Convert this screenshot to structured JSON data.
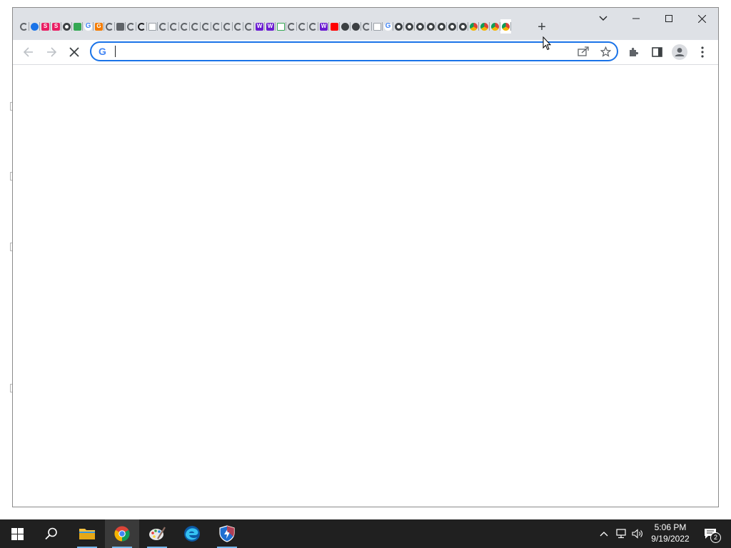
{
  "browser": {
    "app": "Google Chrome",
    "tabs": [
      {
        "icon": "spiral-favicon",
        "color": "#5f6368",
        "shape": "spiral",
        "letter": "",
        "active": false
      },
      {
        "icon": "unknown-favicon",
        "color": "#1a73e8",
        "shape": "round",
        "letter": "",
        "active": false
      },
      {
        "icon": "s-favicon",
        "color": "#e91e63",
        "shape": "square",
        "letter": "S",
        "active": false
      },
      {
        "icon": "s-favicon",
        "color": "#e91e63",
        "shape": "square",
        "letter": "S",
        "active": false
      },
      {
        "icon": "github-favicon",
        "color": "#3c4043",
        "shape": "gh",
        "letter": "",
        "active": false
      },
      {
        "icon": "green-favicon",
        "color": "#34a853",
        "shape": "square",
        "letter": "",
        "active": false
      },
      {
        "icon": "google-favicon",
        "color": "#4285f4",
        "shape": "round",
        "letter": "G",
        "active": false
      },
      {
        "icon": "orange-favicon",
        "color": "#f57c00",
        "shape": "square",
        "letter": "G",
        "active": false
      },
      {
        "icon": "spiral-favicon",
        "color": "#5f6368",
        "shape": "spiral",
        "letter": "",
        "active": false
      },
      {
        "icon": "note-favicon",
        "color": "#5f6368",
        "shape": "square",
        "letter": "",
        "active": false
      },
      {
        "icon": "spiral-favicon",
        "color": "#5f6368",
        "shape": "spiral",
        "letter": "",
        "active": false
      },
      {
        "icon": "spiral-dark-favicon",
        "color": "#202124",
        "shape": "spiral",
        "letter": "",
        "active": false
      },
      {
        "icon": "page-favicon",
        "color": "#9aa0a6",
        "shape": "page",
        "letter": "",
        "active": false
      },
      {
        "icon": "spiral-favicon",
        "color": "#5f6368",
        "shape": "spiral",
        "letter": "",
        "active": false
      },
      {
        "icon": "spiral-favicon",
        "color": "#5f6368",
        "shape": "spiral",
        "letter": "",
        "active": false
      },
      {
        "icon": "spiral-favicon",
        "color": "#5f6368",
        "shape": "spiral",
        "letter": "",
        "active": false
      },
      {
        "icon": "spiral-favicon",
        "color": "#5f6368",
        "shape": "spiral",
        "letter": "",
        "active": false
      },
      {
        "icon": "spiral-favicon",
        "color": "#5f6368",
        "shape": "spiral",
        "letter": "",
        "active": false
      },
      {
        "icon": "spiral-favicon",
        "color": "#5f6368",
        "shape": "spiral",
        "letter": "",
        "active": false
      },
      {
        "icon": "spiral-favicon",
        "color": "#5f6368",
        "shape": "spiral",
        "letter": "",
        "active": false
      },
      {
        "icon": "spiral-favicon",
        "color": "#5f6368",
        "shape": "spiral",
        "letter": "",
        "active": false
      },
      {
        "icon": "spiral-favicon",
        "color": "#5f6368",
        "shape": "spiral",
        "letter": "",
        "active": false
      },
      {
        "icon": "w-favicon",
        "color": "#6a1bd1",
        "shape": "square",
        "letter": "W",
        "active": false
      },
      {
        "icon": "w-favicon",
        "color": "#6a1bd1",
        "shape": "square",
        "letter": "W",
        "active": false
      },
      {
        "icon": "page-favicon",
        "color": "#34a853",
        "shape": "page",
        "letter": "",
        "active": false
      },
      {
        "icon": "spiral-favicon",
        "color": "#5f6368",
        "shape": "spiral",
        "letter": "",
        "active": false
      },
      {
        "icon": "spiral-favicon",
        "color": "#5f6368",
        "shape": "spiral",
        "letter": "",
        "active": false
      },
      {
        "icon": "spiral-favicon",
        "color": "#5f6368",
        "shape": "spiral",
        "letter": "",
        "active": false
      },
      {
        "icon": "w-favicon",
        "color": "#6a1bd1",
        "shape": "square",
        "letter": "W",
        "active": false
      },
      {
        "icon": "youtube-favicon",
        "color": "#ff0000",
        "shape": "square",
        "letter": "",
        "active": false
      },
      {
        "icon": "headphones-favicon",
        "color": "#3c4043",
        "shape": "round",
        "letter": "",
        "active": false
      },
      {
        "icon": "headphones-favicon",
        "color": "#3c4043",
        "shape": "round",
        "letter": "",
        "active": false
      },
      {
        "icon": "spiral-favicon",
        "color": "#5f6368",
        "shape": "spiral",
        "letter": "",
        "active": false
      },
      {
        "icon": "page-favicon",
        "color": "#9aa0a6",
        "shape": "page",
        "letter": "",
        "active": false
      },
      {
        "icon": "google-favicon",
        "color": "#4285f4",
        "shape": "round",
        "letter": "G",
        "active": false
      },
      {
        "icon": "github-favicon",
        "color": "#3c4043",
        "shape": "gh",
        "letter": "",
        "active": false
      },
      {
        "icon": "github-favicon",
        "color": "#3c4043",
        "shape": "gh",
        "letter": "",
        "active": false
      },
      {
        "icon": "github-favicon",
        "color": "#3c4043",
        "shape": "gh",
        "letter": "",
        "active": false
      },
      {
        "icon": "github-favicon",
        "color": "#3c4043",
        "shape": "gh",
        "letter": "",
        "active": false
      },
      {
        "icon": "github-favicon",
        "color": "#3c4043",
        "shape": "gh",
        "letter": "",
        "active": false
      },
      {
        "icon": "github-favicon",
        "color": "#3c4043",
        "shape": "gh",
        "letter": "",
        "active": false
      },
      {
        "icon": "github-favicon",
        "color": "#3c4043",
        "shape": "gh",
        "letter": "",
        "active": false
      },
      {
        "icon": "chrome-favicon",
        "color": "#5f6368",
        "shape": "chrome",
        "letter": "",
        "active": false
      },
      {
        "icon": "chrome-favicon",
        "color": "#5f6368",
        "shape": "chrome",
        "letter": "",
        "active": false
      },
      {
        "icon": "chrome-favicon",
        "color": "#5f6368",
        "shape": "chrome",
        "letter": "",
        "active": false
      },
      {
        "icon": "chrome-favicon",
        "color": "#5f6368",
        "shape": "chrome",
        "letter": "",
        "active": true
      }
    ],
    "new_tab_symbol": "+",
    "window_controls": {
      "tab_search": "⌄",
      "minimize": "—",
      "maximize": "☐",
      "close": "✕"
    },
    "omnibox": {
      "value": "",
      "placeholder": "",
      "focused": true,
      "search_engine_icon": "google-g-icon",
      "google_letter": "G"
    },
    "toolbar": {
      "back_icon": "back-arrow-icon",
      "forward_icon": "forward-arrow-icon",
      "stop_icon": "stop-loading-icon",
      "share_icon": "share-icon",
      "bookmark_icon": "star-icon",
      "extensions_icon": "puzzle-icon",
      "side_panel_icon": "side-panel-icon",
      "profile_icon": "profile-icon",
      "menu_icon": "kebab-menu-icon"
    },
    "page": {
      "loading": true,
      "content": ""
    },
    "accent_color": "#1a73e8"
  },
  "taskbar": {
    "background": "#202020",
    "items": [
      {
        "name": "start",
        "icon": "windows-logo-icon"
      },
      {
        "name": "search",
        "icon": "search-icon"
      },
      {
        "name": "file-explorer",
        "icon": "folder-icon",
        "running": true
      },
      {
        "name": "chrome",
        "icon": "chrome-icon",
        "running": true,
        "focused": true
      },
      {
        "name": "paint",
        "icon": "palette-icon",
        "running": true
      },
      {
        "name": "edge",
        "icon": "edge-icon",
        "running": false
      },
      {
        "name": "defender",
        "icon": "shield-icon",
        "running": true
      }
    ],
    "tray": {
      "chevron": "^",
      "network_icon": "network-icon",
      "volume_icon": "volume-icon",
      "time": "5:06 PM",
      "date": "9/19/2022",
      "notifications": "2"
    }
  }
}
